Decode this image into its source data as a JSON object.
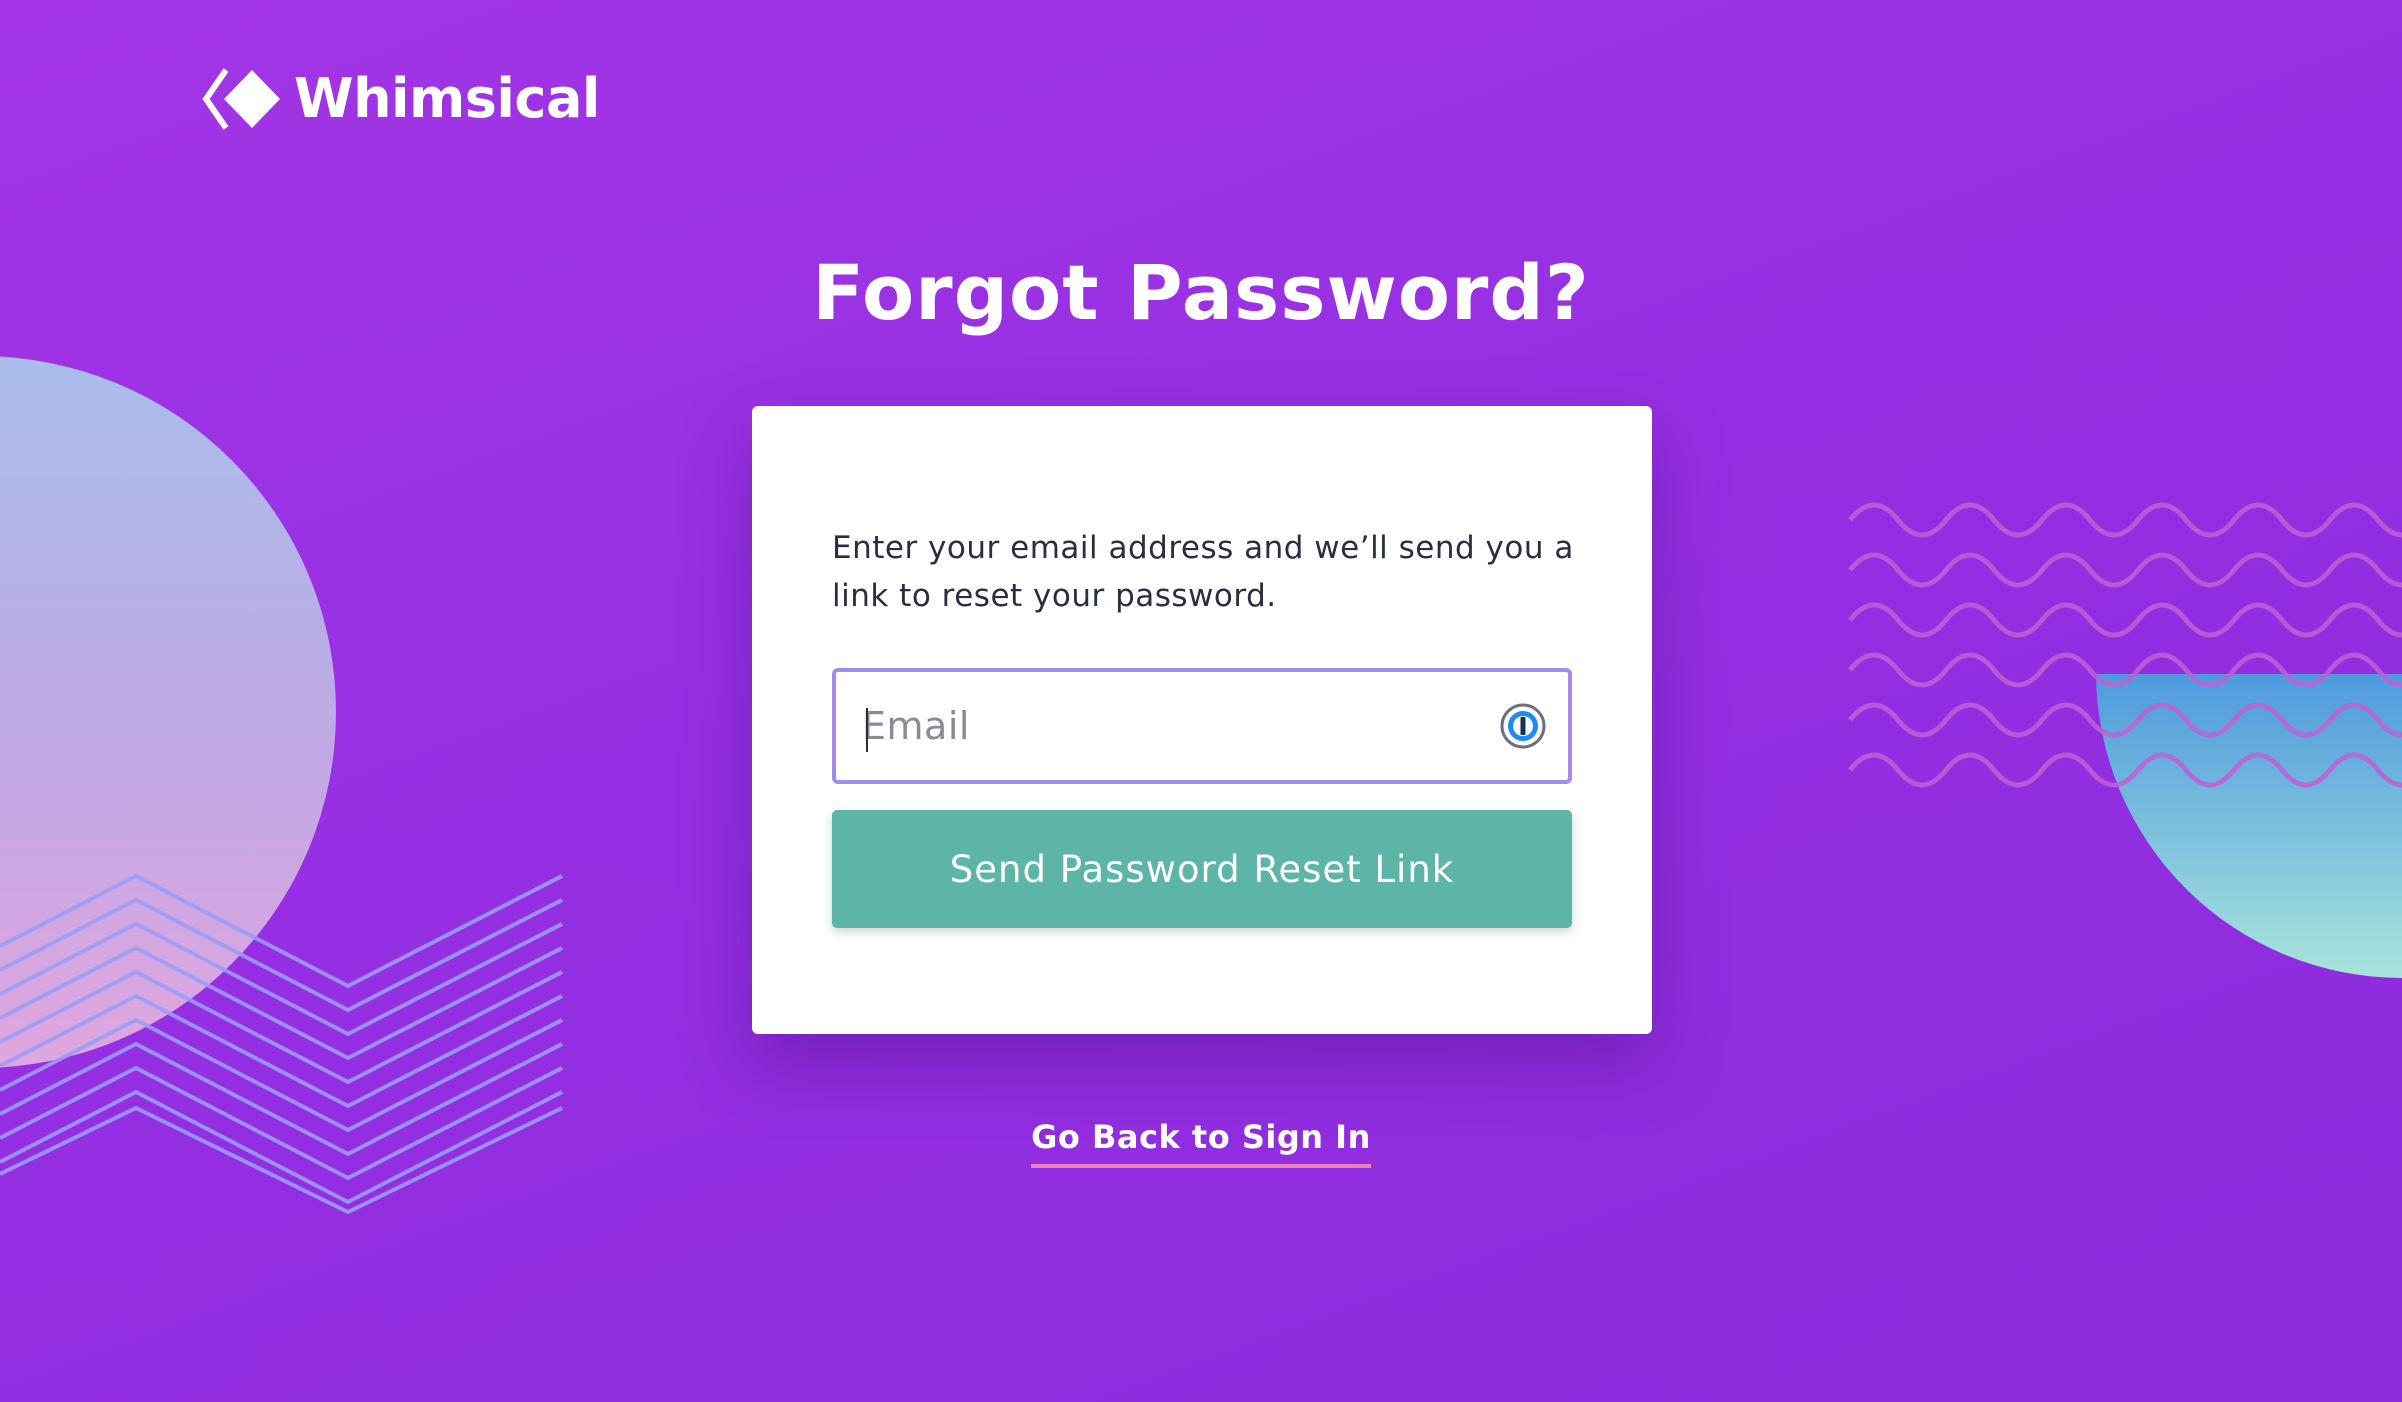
{
  "brand": {
    "name": "Whimsical",
    "icon": "whimsical-logo-icon"
  },
  "page": {
    "title": "Forgot Password?"
  },
  "form": {
    "instructions": "Enter your email address and we’ll send you a link to reset your password.",
    "email": {
      "placeholder": "Email",
      "value": ""
    },
    "password_manager_icon": "password-manager-icon",
    "submit_label": "Send Password Reset Link"
  },
  "footer": {
    "back_link_label": "Go Back to Sign In"
  },
  "colors": {
    "background_start": "#a236e6",
    "background_end": "#8a2cdc",
    "button": "#5cb5a7",
    "input_border": "#a28bf0",
    "link_underline": "#f07fb4",
    "text_dark": "#2b2d42"
  }
}
